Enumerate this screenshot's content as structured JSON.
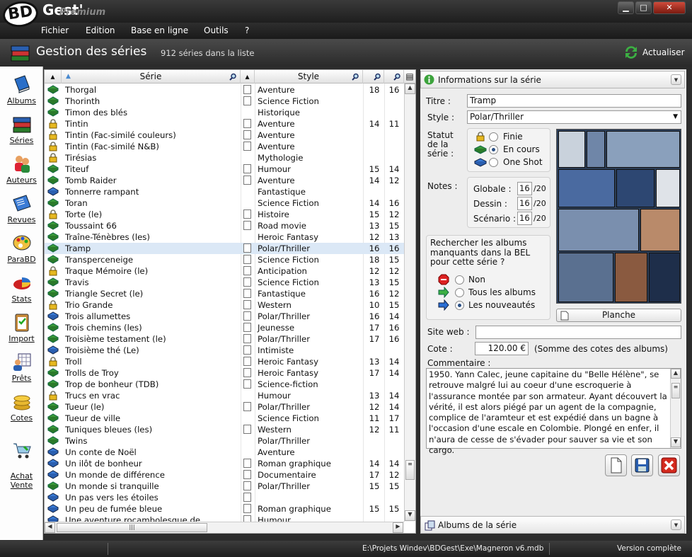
{
  "app": {
    "logo": "BD",
    "name": "Gest'",
    "edition": "Premium"
  },
  "menu": [
    "Fichier",
    "Edition",
    "Base en ligne",
    "Outils",
    "?"
  ],
  "header": {
    "title": "Gestion des séries",
    "count": "912 séries dans la liste",
    "refresh": "Actualiser"
  },
  "sidebar": [
    "Albums",
    "Séries",
    "Auteurs",
    "Revues",
    "ParaBD",
    "Stats",
    "Import",
    "Prêts",
    "Cotes",
    "Achat\nVente"
  ],
  "list": {
    "col_serie": "Série",
    "col_style": "Style",
    "rows": [
      {
        "name": "Thorgal",
        "status": "en-cours",
        "doc": true,
        "style": "Aventure",
        "a": "18",
        "b": "16"
      },
      {
        "name": "Thorinth",
        "status": "en-cours",
        "doc": true,
        "style": "Science Fiction",
        "a": "",
        "b": ""
      },
      {
        "name": "Timon des blés",
        "status": "en-cours",
        "doc": false,
        "style": "Historique",
        "a": "",
        "b": ""
      },
      {
        "name": "Tintin",
        "status": "finie",
        "doc": true,
        "style": "Aventure",
        "a": "14",
        "b": "11"
      },
      {
        "name": "Tintin (Fac-similé couleurs)",
        "status": "finie",
        "doc": true,
        "style": "Aventure",
        "a": "",
        "b": ""
      },
      {
        "name": "Tintin (Fac-similé N&B)",
        "status": "finie",
        "doc": true,
        "style": "Aventure",
        "a": "",
        "b": ""
      },
      {
        "name": "Tirésias",
        "status": "finie",
        "doc": false,
        "style": "Mythologie",
        "a": "",
        "b": ""
      },
      {
        "name": "Titeuf",
        "status": "en-cours",
        "doc": true,
        "style": "Humour",
        "a": "15",
        "b": "14"
      },
      {
        "name": "Tomb Raider",
        "status": "en-cours",
        "doc": true,
        "style": "Aventure",
        "a": "14",
        "b": "12"
      },
      {
        "name": "Tonnerre rampant",
        "status": "one-shot",
        "doc": false,
        "style": "Fantastique",
        "a": "",
        "b": ""
      },
      {
        "name": "Toran",
        "status": "en-cours",
        "doc": false,
        "style": "Science Fiction",
        "a": "14",
        "b": "16"
      },
      {
        "name": "Torte (le)",
        "status": "finie",
        "doc": true,
        "style": "Histoire",
        "a": "15",
        "b": "12"
      },
      {
        "name": "Toussaint 66",
        "status": "en-cours",
        "doc": true,
        "style": "Road movie",
        "a": "13",
        "b": "15"
      },
      {
        "name": "Traîne-Ténèbres (les)",
        "status": "en-cours",
        "doc": false,
        "style": "Heroic Fantasy",
        "a": "12",
        "b": "13"
      },
      {
        "name": "Tramp",
        "status": "en-cours",
        "doc": true,
        "style": "Polar/Thriller",
        "a": "16",
        "b": "16",
        "sel": true
      },
      {
        "name": "Transperceneige",
        "status": "en-cours",
        "doc": true,
        "style": "Science Fiction",
        "a": "18",
        "b": "15"
      },
      {
        "name": "Traque Mémoire (le)",
        "status": "finie",
        "doc": true,
        "style": "Anticipation",
        "a": "12",
        "b": "12"
      },
      {
        "name": "Travis",
        "status": "en-cours",
        "doc": true,
        "style": "Science Fiction",
        "a": "13",
        "b": "15"
      },
      {
        "name": "Triangle Secret (le)",
        "status": "en-cours",
        "doc": true,
        "style": "Fantastique",
        "a": "16",
        "b": "12"
      },
      {
        "name": "Trio Grande",
        "status": "finie",
        "doc": true,
        "style": "Western",
        "a": "10",
        "b": "15"
      },
      {
        "name": "Trois allumettes",
        "status": "one-shot",
        "doc": true,
        "style": "Polar/Thriller",
        "a": "16",
        "b": "14"
      },
      {
        "name": "Trois chemins (les)",
        "status": "en-cours",
        "doc": true,
        "style": "Jeunesse",
        "a": "17",
        "b": "16"
      },
      {
        "name": "Troisième testament (le)",
        "status": "en-cours",
        "doc": true,
        "style": "Polar/Thriller",
        "a": "17",
        "b": "16"
      },
      {
        "name": "Troisième thé (Le)",
        "status": "one-shot",
        "doc": true,
        "style": "Intimiste",
        "a": "",
        "b": ""
      },
      {
        "name": "Troll",
        "status": "finie",
        "doc": true,
        "style": "Heroic Fantasy",
        "a": "13",
        "b": "14"
      },
      {
        "name": "Trolls de Troy",
        "status": "en-cours",
        "doc": true,
        "style": "Heroic Fantasy",
        "a": "17",
        "b": "14"
      },
      {
        "name": "Trop de bonheur (TDB)",
        "status": "en-cours",
        "doc": true,
        "style": "Science-fiction",
        "a": "",
        "b": ""
      },
      {
        "name": "Trucs en vrac",
        "status": "finie",
        "doc": false,
        "style": "Humour",
        "a": "13",
        "b": "14"
      },
      {
        "name": "Tueur (le)",
        "status": "en-cours",
        "doc": true,
        "style": "Polar/Thriller",
        "a": "12",
        "b": "14"
      },
      {
        "name": "Tueur de ville",
        "status": "en-cours",
        "doc": false,
        "style": "Science Fiction",
        "a": "11",
        "b": "17"
      },
      {
        "name": "Tuniques bleues (les)",
        "status": "en-cours",
        "doc": true,
        "style": "Western",
        "a": "12",
        "b": "11"
      },
      {
        "name": "Twins",
        "status": "en-cours",
        "doc": false,
        "style": "Polar/Thriller",
        "a": "",
        "b": ""
      },
      {
        "name": "Un conte de Noël",
        "status": "one-shot",
        "doc": false,
        "style": "Aventure",
        "a": "",
        "b": ""
      },
      {
        "name": "Un ilôt de bonheur",
        "status": "one-shot",
        "doc": true,
        "style": "Roman graphique",
        "a": "14",
        "b": "14"
      },
      {
        "name": "Un monde de différence",
        "status": "one-shot",
        "doc": true,
        "style": "Documentaire",
        "a": "17",
        "b": "12"
      },
      {
        "name": "Un monde si tranquille",
        "status": "en-cours",
        "doc": true,
        "style": "Polar/Thriller",
        "a": "15",
        "b": "15"
      },
      {
        "name": "Un pas vers les étoiles",
        "status": "one-shot",
        "doc": true,
        "style": "",
        "a": "",
        "b": ""
      },
      {
        "name": "Un peu de fumée bleue",
        "status": "one-shot",
        "doc": true,
        "style": "Roman graphique",
        "a": "15",
        "b": "15"
      },
      {
        "name": "Une aventure rocambolesque de...",
        "status": "one-shot",
        "doc": true,
        "style": "Humour",
        "a": "",
        "b": ""
      }
    ]
  },
  "info": {
    "section_title": "Informations sur la série",
    "titre_label": "Titre :",
    "titre": "Tramp",
    "style_label": "Style :",
    "style": "Polar/Thriller",
    "statut_label": "Statut\nde la\nsérie :",
    "statut_opts": [
      "Finie",
      "En cours",
      "One Shot"
    ],
    "statut_selected": 1,
    "notes_label": "Notes :",
    "notes": [
      {
        "label": "Globale :",
        "value": "16"
      },
      {
        "label": "Dessin :",
        "value": "16"
      },
      {
        "label": "Scénario :",
        "value": "16"
      }
    ],
    "notes_max": "/20",
    "search_text": "Rechercher les albums\nmanquants dans la BEL\npour cette série ?",
    "search_opts": [
      "Non",
      "Tous les albums",
      "Les nouveautés"
    ],
    "search_selected": 2,
    "planche": "Planche",
    "site_label": "Site web :",
    "site": "",
    "cote_label": "Cote :",
    "cote": "120.00 €",
    "cote_note": "(Somme des cotes des albums)",
    "comment_label": "Commentaire :",
    "comment": "1950. Yann Calec, jeune capitaine du \"Belle Hélène\", se retrouve malgré lui au coeur d'une escroquerie à l'assurance montée par son armateur. Ayant découvert la vérité, il est alors piégé par un agent de la compagnie, complice de l'aramteur et est expédié dans un bagne à l'occasion d'une escale en Colombie. Plongé en enfer, il n'aura de cesse de s'évader pour sauver sa vie et son cargo.",
    "albums_section": "Albums de la série"
  },
  "status": {
    "path": "E:\\Projets Windev\\BDGest\\Exe\\Magneron v6.mdb",
    "version": "Version complète"
  }
}
